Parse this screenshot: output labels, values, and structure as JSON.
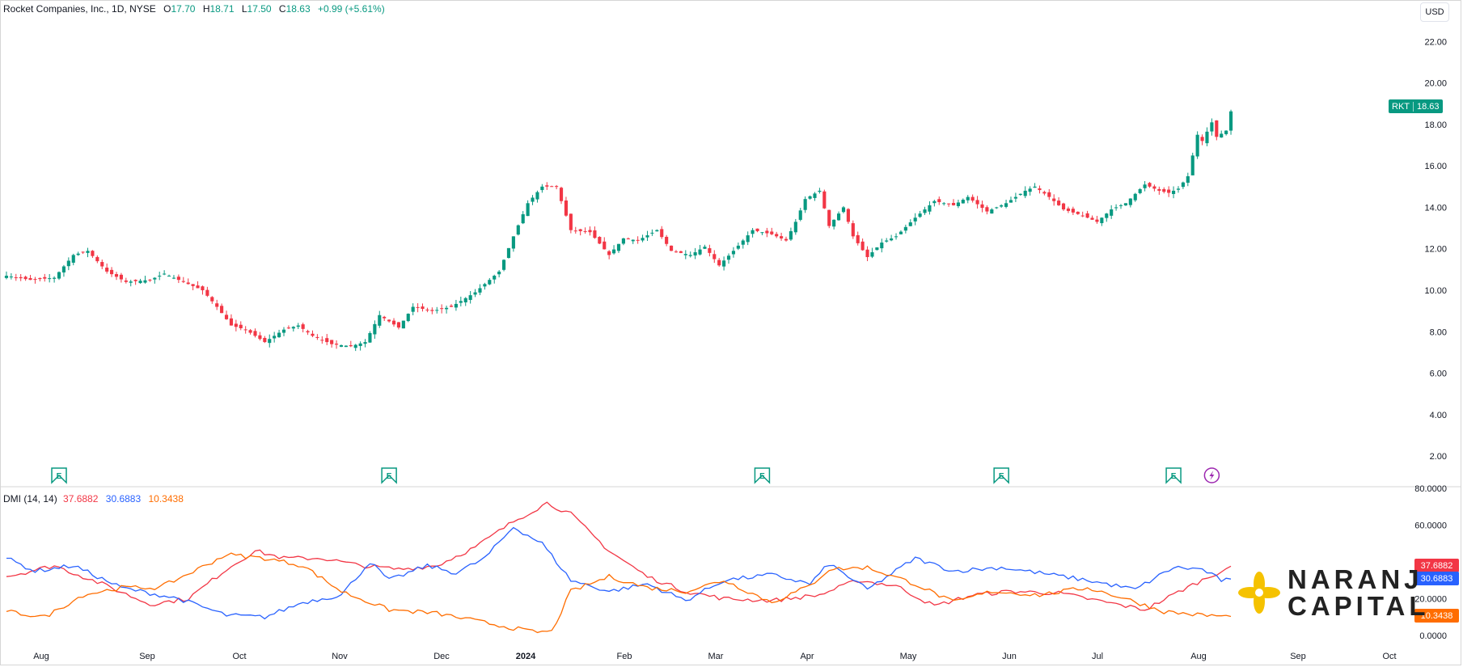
{
  "header": {
    "title": "Rocket Companies, Inc., 1D, NYSE",
    "open_label": "O",
    "open": "17.70",
    "high_label": "H",
    "high": "18.71",
    "low_label": "L",
    "low": "17.50",
    "close_label": "C",
    "close": "18.63",
    "change": "+0.99 (+5.61%)"
  },
  "currency": "USD",
  "last_price": {
    "symbol": "RKT",
    "value": "18.63"
  },
  "dmi": {
    "label": "DMI (14, 14)",
    "plus_di": "37.6882",
    "minus_di": "30.6883",
    "adx": "10.3438"
  },
  "logo": {
    "line1": "NARANJ",
    "line2": "CAPITAL"
  },
  "colors": {
    "up": "#089981",
    "down": "#f23645",
    "plus_di": "#f23645",
    "minus_di": "#2962ff",
    "adx": "#ff6d00",
    "earnings": "#089981",
    "dividend": "#9c27b0",
    "logo_accent": "#f5c200"
  },
  "chart_data": [
    {
      "type": "candlestick",
      "x_axis_labels": [
        "Aug",
        "Sep",
        "Oct",
        "Nov",
        "Dec",
        "2024",
        "Feb",
        "Mar",
        "Apr",
        "May",
        "Jun",
        "Jul",
        "Aug",
        "Sep",
        "Oct"
      ],
      "y_ticks": [
        2,
        4,
        6,
        8,
        10,
        12,
        14,
        16,
        18,
        20,
        22
      ],
      "y_tick_labels": [
        "2.00",
        "4.00",
        "6.00",
        "8.00",
        "10.00",
        "12.00",
        "14.00",
        "16.00",
        "18.00",
        "20.00",
        "22.00"
      ],
      "ylim": [
        0.6,
        23.3
      ],
      "close_anchors": [
        [
          0,
          10.7
        ],
        [
          5,
          10.5
        ],
        [
          10,
          10.6
        ],
        [
          14,
          11.7
        ],
        [
          17,
          11.9
        ],
        [
          21,
          10.9
        ],
        [
          25,
          10.4
        ],
        [
          30,
          10.5
        ],
        [
          33,
          10.8
        ],
        [
          37,
          10.4
        ],
        [
          41,
          10.0
        ],
        [
          44,
          9.2
        ],
        [
          47,
          8.3
        ],
        [
          50,
          8.1
        ],
        [
          54,
          7.5
        ],
        [
          58,
          8.1
        ],
        [
          61,
          8.3
        ],
        [
          64,
          7.8
        ],
        [
          68,
          7.4
        ],
        [
          72,
          7.3
        ],
        [
          75,
          7.5
        ],
        [
          78,
          8.8
        ],
        [
          82,
          8.2
        ],
        [
          85,
          9.2
        ],
        [
          89,
          9.0
        ],
        [
          93,
          9.2
        ],
        [
          98,
          9.9
        ],
        [
          103,
          10.9
        ],
        [
          106,
          12.6
        ],
        [
          109,
          14.2
        ],
        [
          112,
          15.0
        ],
        [
          115,
          15.0
        ],
        [
          116,
          14.3
        ],
        [
          118,
          12.9
        ],
        [
          122,
          12.8
        ],
        [
          126,
          11.7
        ],
        [
          129,
          12.5
        ],
        [
          132,
          12.4
        ],
        [
          136,
          12.9
        ],
        [
          139,
          11.9
        ],
        [
          143,
          11.7
        ],
        [
          146,
          12.1
        ],
        [
          149,
          11.2
        ],
        [
          152,
          11.9
        ],
        [
          156,
          12.9
        ],
        [
          160,
          12.7
        ],
        [
          163,
          12.4
        ],
        [
          165,
          13.3
        ],
        [
          167,
          14.4
        ],
        [
          170,
          14.8
        ],
        [
          172,
          13.1
        ],
        [
          175,
          14.0
        ],
        [
          177,
          12.6
        ],
        [
          180,
          11.6
        ],
        [
          183,
          12.3
        ],
        [
          186,
          12.6
        ],
        [
          190,
          13.5
        ],
        [
          194,
          14.3
        ],
        [
          198,
          14.1
        ],
        [
          201,
          14.5
        ],
        [
          205,
          13.8
        ],
        [
          209,
          14.2
        ],
        [
          213,
          14.8
        ],
        [
          215,
          15.0
        ],
        [
          218,
          14.5
        ],
        [
          221,
          13.9
        ],
        [
          225,
          13.6
        ],
        [
          228,
          13.3
        ],
        [
          231,
          13.9
        ],
        [
          234,
          14.2
        ],
        [
          238,
          15.1
        ],
        [
          241,
          14.8
        ],
        [
          243,
          14.7
        ],
        [
          245,
          14.9
        ],
        [
          247,
          15.5
        ],
        [
          249,
          17.5
        ],
        [
          250,
          17.2
        ],
        [
          252,
          18.1
        ],
        [
          253,
          17.4
        ],
        [
          255,
          17.7
        ],
        [
          256,
          18.63
        ]
      ],
      "last_candle": {
        "open": 17.7,
        "high": 18.71,
        "low": 17.5,
        "close": 18.63
      },
      "earnings_markers_bar_index": [
        11,
        80,
        158,
        208,
        244
      ],
      "dividend_marker_bar_index": [
        252
      ],
      "bars_count": 257
    },
    {
      "type": "line",
      "title": "DMI (14, 14)",
      "y_ticks": [
        0,
        20,
        40,
        60,
        80
      ],
      "y_tick_labels": [
        "0.0000",
        "20.0000",
        "40.0000",
        "60.0000",
        "80.0000"
      ],
      "ylim": [
        0,
        80
      ],
      "series": [
        {
          "name": "+DI",
          "anchors": [
            [
              0,
              32
            ],
            [
              10,
              38
            ],
            [
              20,
              28
            ],
            [
              30,
              17
            ],
            [
              38,
              20
            ],
            [
              46,
              36
            ],
            [
              52,
              46
            ],
            [
              58,
              42
            ],
            [
              66,
              42
            ],
            [
              74,
              38
            ],
            [
              82,
              36
            ],
            [
              90,
              38
            ],
            [
              98,
              48
            ],
            [
              106,
              62
            ],
            [
              113,
              72
            ],
            [
              118,
              66
            ],
            [
              126,
              46
            ],
            [
              134,
              32
            ],
            [
              142,
              24
            ],
            [
              150,
              20
            ],
            [
              160,
              19
            ],
            [
              170,
              22
            ],
            [
              178,
              30
            ],
            [
              186,
              27
            ],
            [
              194,
              16
            ],
            [
              202,
              22
            ],
            [
              210,
              24
            ],
            [
              220,
              23
            ],
            [
              230,
              18
            ],
            [
              238,
              14
            ],
            [
              246,
              25
            ],
            [
              256,
              37.69
            ]
          ]
        },
        {
          "name": "-DI",
          "anchors": [
            [
              0,
              42
            ],
            [
              6,
              35
            ],
            [
              14,
              38
            ],
            [
              24,
              26
            ],
            [
              36,
              20
            ],
            [
              46,
              11
            ],
            [
              54,
              10
            ],
            [
              62,
              18
            ],
            [
              70,
              22
            ],
            [
              76,
              40
            ],
            [
              80,
              30
            ],
            [
              88,
              38
            ],
            [
              94,
              34
            ],
            [
              100,
              42
            ],
            [
              106,
              59
            ],
            [
              112,
              50
            ],
            [
              118,
              30
            ],
            [
              126,
              24
            ],
            [
              134,
              28
            ],
            [
              142,
              19
            ],
            [
              150,
              30
            ],
            [
              160,
              33
            ],
            [
              168,
              28
            ],
            [
              172,
              39
            ],
            [
              180,
              25
            ],
            [
              190,
              42
            ],
            [
              198,
              35
            ],
            [
              208,
              37
            ],
            [
              216,
              34
            ],
            [
              226,
              30
            ],
            [
              236,
              25
            ],
            [
              244,
              37
            ],
            [
              250,
              36
            ],
            [
              254,
              30
            ],
            [
              256,
              30.69
            ]
          ]
        },
        {
          "name": "ADX",
          "anchors": [
            [
              0,
              13
            ],
            [
              8,
              10
            ],
            [
              16,
              22
            ],
            [
              24,
              26
            ],
            [
              32,
              26
            ],
            [
              40,
              36
            ],
            [
              46,
              44
            ],
            [
              54,
              42
            ],
            [
              62,
              38
            ],
            [
              70,
              24
            ],
            [
              80,
              14
            ],
            [
              90,
              12
            ],
            [
              100,
              7
            ],
            [
              110,
              2
            ],
            [
              114,
              2
            ],
            [
              118,
              24
            ],
            [
              126,
              32
            ],
            [
              134,
              26
            ],
            [
              142,
              24
            ],
            [
              150,
              30
            ],
            [
              160,
              18
            ],
            [
              168,
              27
            ],
            [
              172,
              36
            ],
            [
              180,
              37
            ],
            [
              190,
              28
            ],
            [
              198,
              18
            ],
            [
              206,
              24
            ],
            [
              216,
              22
            ],
            [
              226,
              26
            ],
            [
              234,
              20
            ],
            [
              242,
              13
            ],
            [
              250,
              11
            ],
            [
              256,
              10.34
            ]
          ]
        }
      ]
    }
  ]
}
